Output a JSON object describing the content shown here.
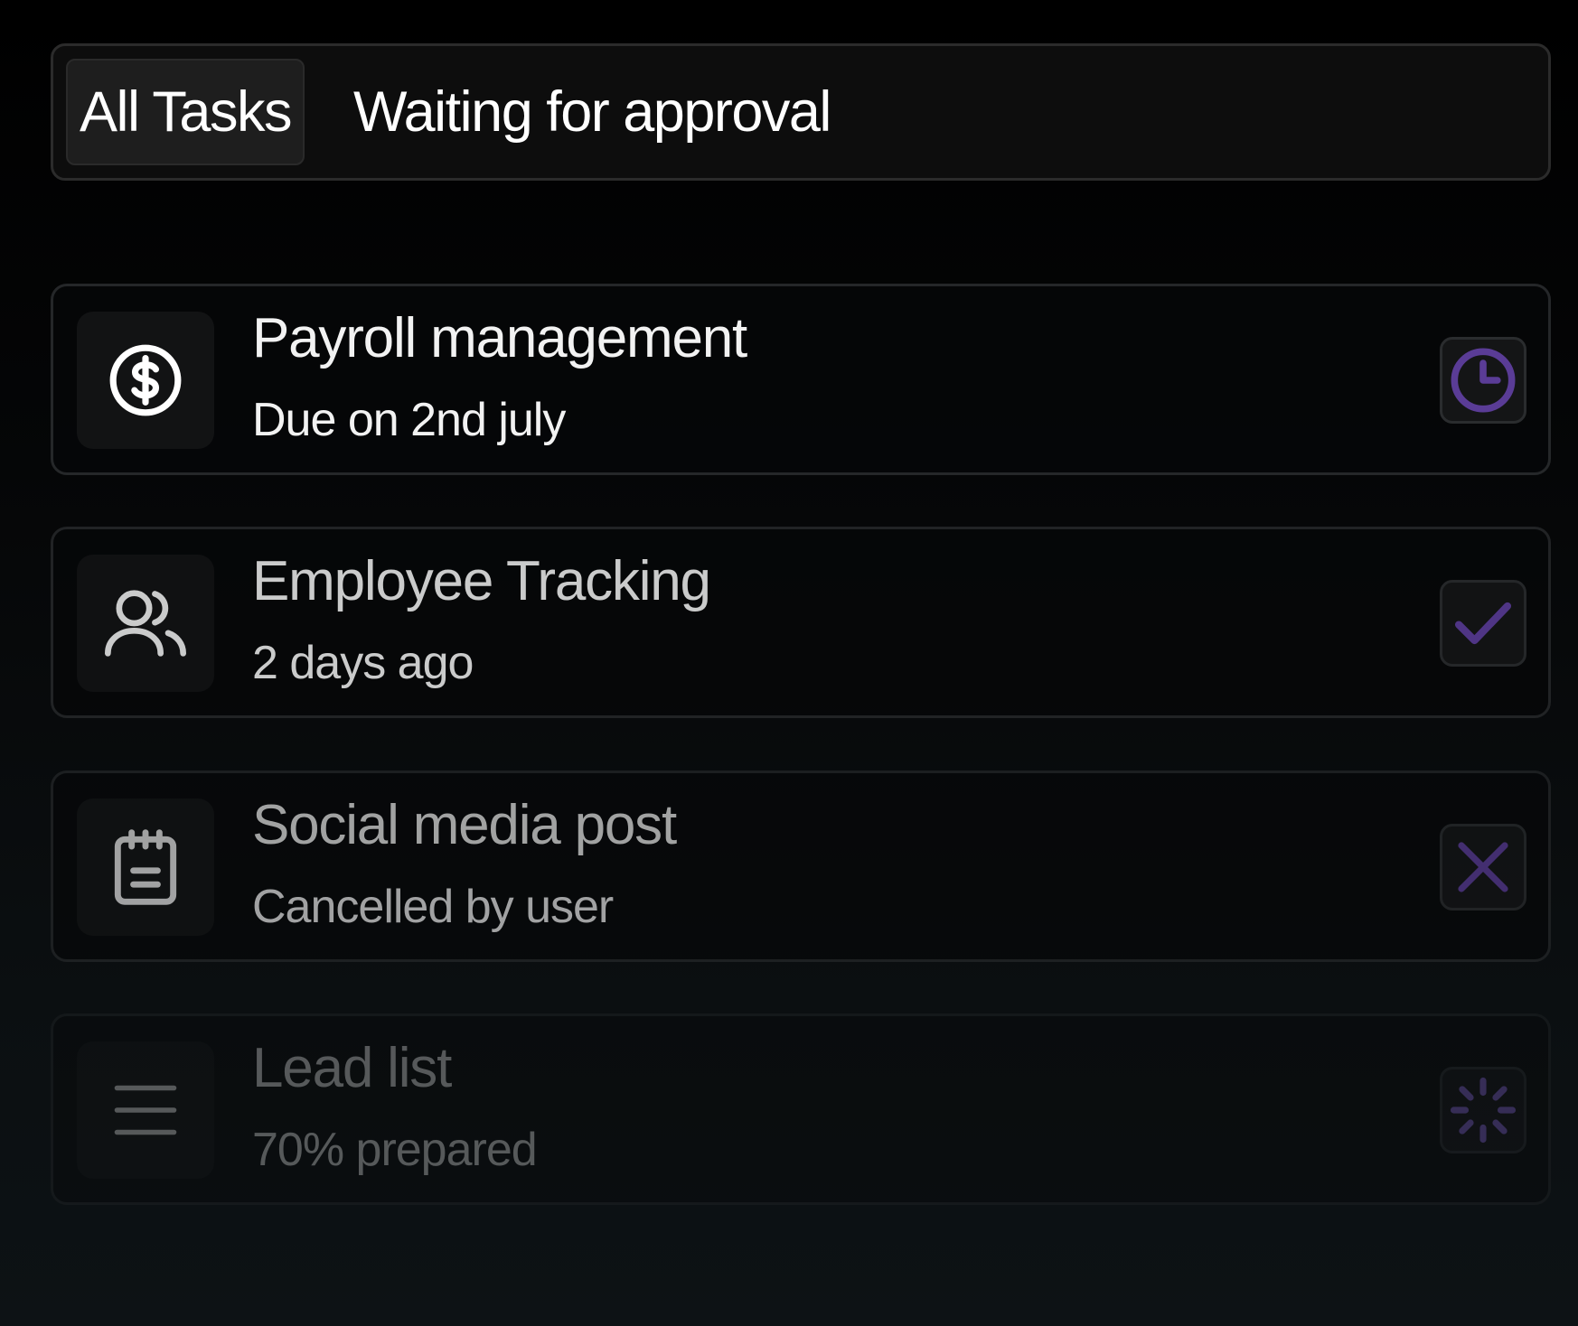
{
  "tabs": [
    {
      "label": "All Tasks",
      "active": true
    },
    {
      "label": "Waiting for approval",
      "active": false
    }
  ],
  "tasks": [
    {
      "title": "Payroll management",
      "subtitle": "Due on 2nd july",
      "icon": "dollar-circle-icon",
      "status_icon": "clock-icon",
      "status": "pending"
    },
    {
      "title": "Employee Tracking",
      "subtitle": "2 days ago",
      "icon": "users-icon",
      "status_icon": "check-icon",
      "status": "done"
    },
    {
      "title": "Social media post",
      "subtitle": "Cancelled by user",
      "icon": "notepad-icon",
      "status_icon": "close-icon",
      "status": "cancelled"
    },
    {
      "title": "Lead list",
      "subtitle": "70% prepared",
      "icon": "menu-lines-icon",
      "status_icon": "loader-icon",
      "status": "in-progress"
    }
  ],
  "colors": {
    "accent": "#5a3c96",
    "card_border": "#252729",
    "text": "#f2f2f2"
  }
}
